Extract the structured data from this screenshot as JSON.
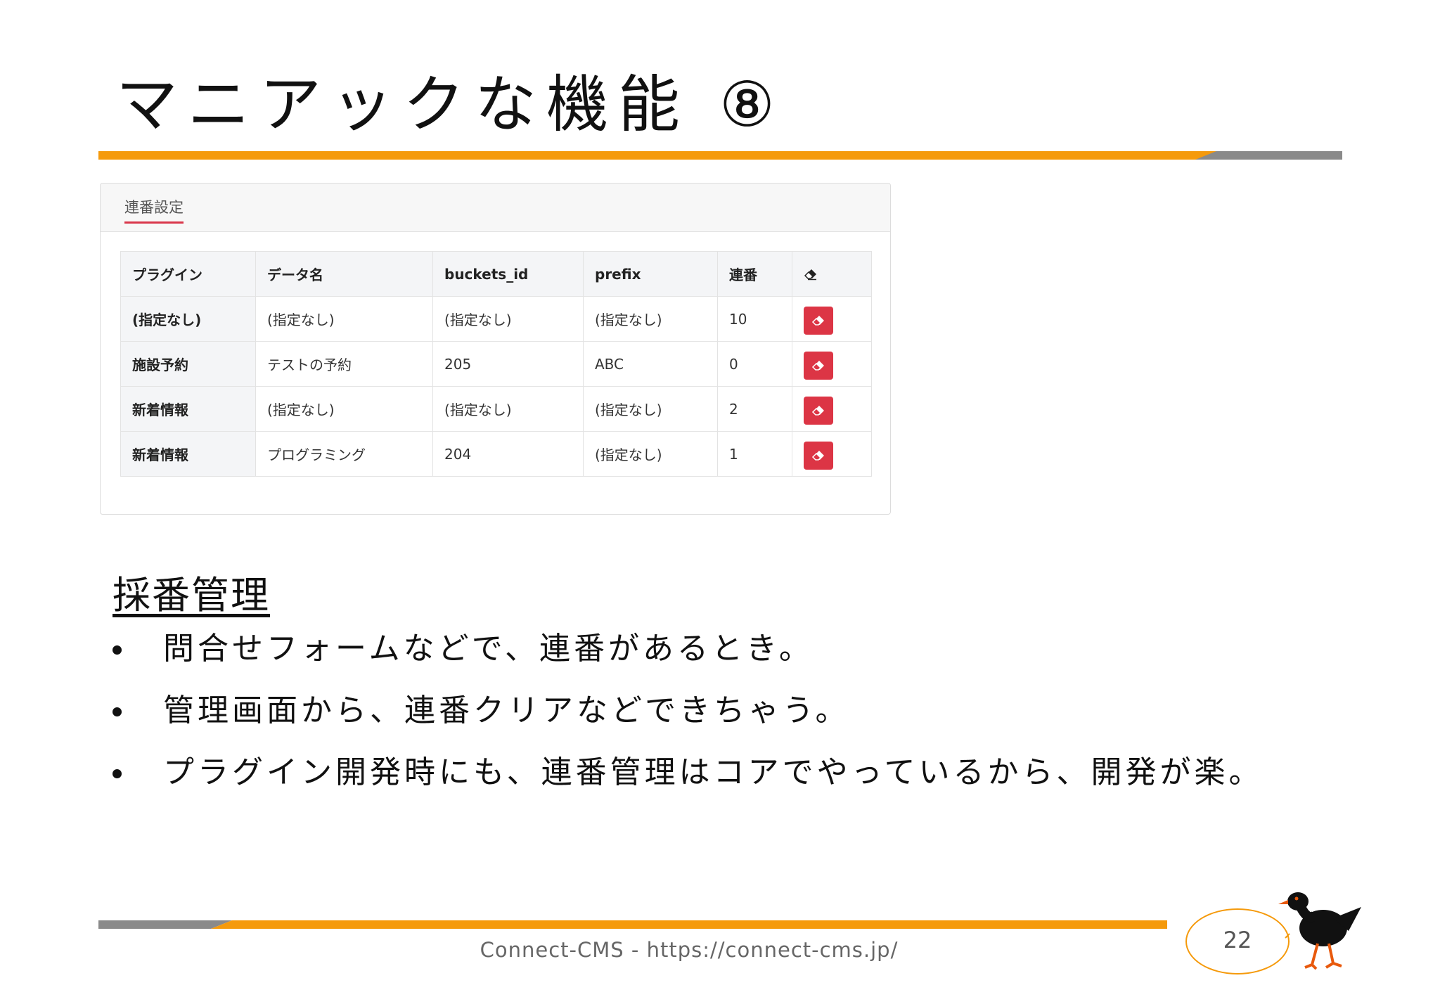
{
  "slide": {
    "title": "マニアックな機能 ⑧",
    "page_number": "22",
    "footer": "Connect-CMS - https://connect-cms.jp/"
  },
  "panel": {
    "tab_label": "連番設定",
    "table": {
      "headers": [
        "プラグイン",
        "データ名",
        "buckets_id",
        "prefix",
        "連番"
      ],
      "rows": [
        [
          "(指定なし)",
          "(指定なし)",
          "(指定なし)",
          "(指定なし)",
          "10"
        ],
        [
          "施設予約",
          "テストの予約",
          "205",
          "ABC",
          "0"
        ],
        [
          "新着情報",
          "(指定なし)",
          "(指定なし)",
          "(指定なし)",
          "2"
        ],
        [
          "新着情報",
          "プログラミング",
          "204",
          "(指定なし)",
          "1"
        ]
      ]
    },
    "delete_icon": "eraser-icon",
    "delete_color": "#dc3545"
  },
  "section": {
    "heading": "採番管理",
    "bullets": [
      "問合せフォームなどで、連番があるとき。",
      "管理画面から、連番クリアなどできちゃう。",
      "プラグイン開発時にも、連番管理はコアでやっているから、開発が楽。"
    ]
  },
  "colors": {
    "accent": "#f59a0c",
    "gray_bar": "#8a8a8a",
    "tab_underline": "#d9364a"
  }
}
